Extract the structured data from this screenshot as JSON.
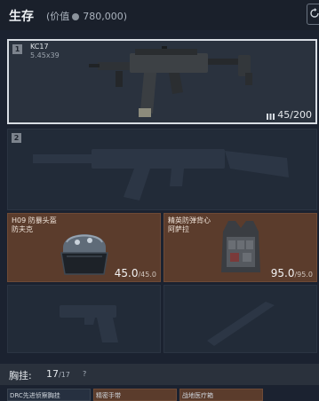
{
  "header": {
    "title": "生存",
    "value_label": "(价值",
    "value_amount": "780,000)"
  },
  "slots": {
    "primary": {
      "number": "1",
      "name": "KC17",
      "caliber": "5.45x39",
      "ammo_current": "45",
      "ammo_max": "/200"
    },
    "secondary": {
      "number": "2"
    },
    "helmet": {
      "name_line1": "H09 防暴头盔",
      "name_line2": "防夫克",
      "durability": "45.0",
      "durability_max": "/45.0"
    },
    "armor": {
      "name_line1": "精英防弹背心",
      "name_line2": "阿萨拉",
      "durability": "95.0",
      "durability_max": "/95.0"
    }
  },
  "chest_rig": {
    "label": "胸挂:",
    "count": "17",
    "max": "/17",
    "help": "?"
  },
  "bottom_slots": [
    {
      "label": "DRC先进侦察胸挂"
    },
    {
      "label": "精密手带"
    },
    {
      "label": "战地医疗箱"
    }
  ],
  "colors": {
    "background": "#1b2230",
    "gear_slot": "#5b3c2c",
    "selected_border": "#d8dde4"
  }
}
